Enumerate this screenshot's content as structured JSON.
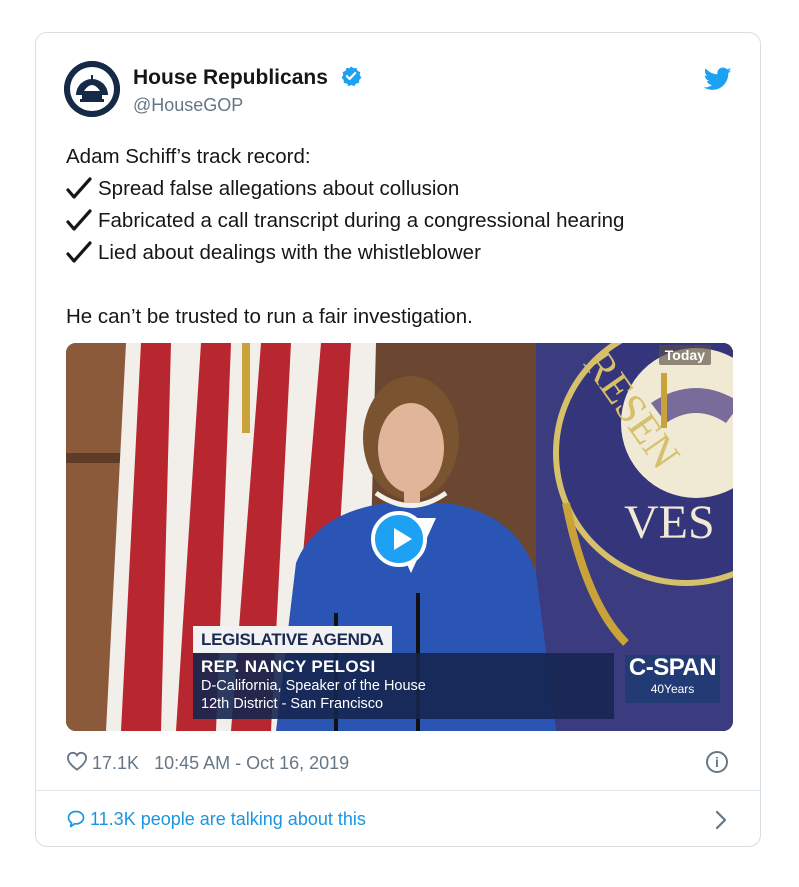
{
  "tweet": {
    "author_name": "House Republicans",
    "author_handle": "@HouseGOP",
    "intro": "Adam Schiff’s track record:",
    "checklist": [
      "Spread false allegations about collusion",
      "Fabricated a call transcript during a congressional hearing",
      "Lied about dealings with the whistleblower"
    ],
    "closing": "He can’t be trusted to run a fair investigation."
  },
  "media": {
    "badge": "Today",
    "chyron_title": "LEGISLATIVE AGENDA",
    "chyron_name": "REP. NANCY PELOSI",
    "chyron_line1": "D-California, Speaker of the House",
    "chyron_line2": "12th District - San Francisco",
    "network_logo": "C-SPAN",
    "network_years": "40Years",
    "seal_text_1": "RESEN",
    "seal_text_2": "VES"
  },
  "meta": {
    "likes": "17.1K",
    "timestamp": "10:45 AM - Oct 16, 2019"
  },
  "footer": {
    "talking": "11.3K people are talking about this"
  },
  "icons": {
    "verified": "verified-badge-icon",
    "bird": "twitter-bird-icon",
    "check": "checkmark-icon",
    "play": "play-icon",
    "heart": "heart-icon",
    "info": "info-icon",
    "comment": "comment-bubble-icon",
    "chevron": "chevron-right-icon"
  },
  "colors": {
    "accent": "#1da1f2",
    "link": "#1b95e0",
    "muted": "#657786",
    "text": "#14171a"
  }
}
